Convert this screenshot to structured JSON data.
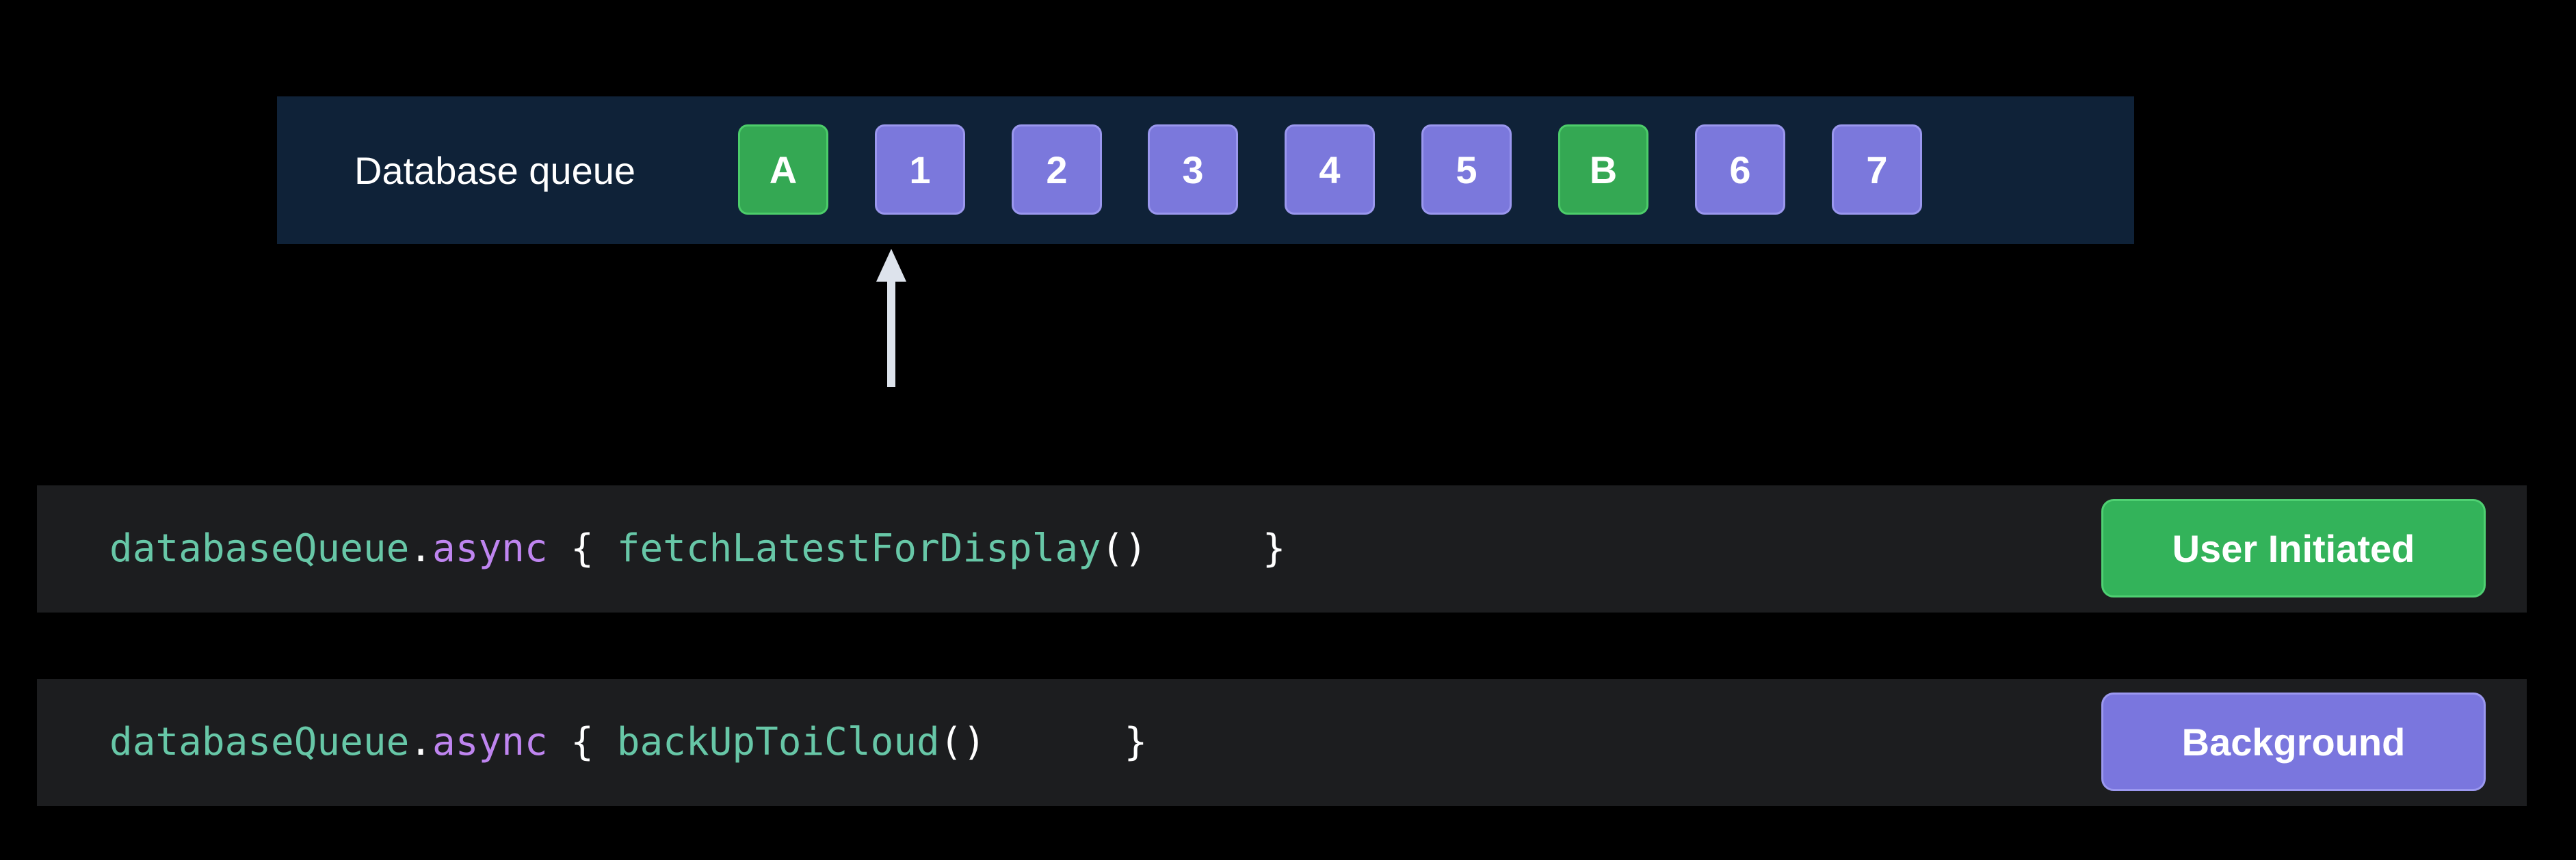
{
  "queue": {
    "label": "Database queue",
    "items": [
      {
        "text": "A",
        "kind": "green"
      },
      {
        "text": "1",
        "kind": "purple"
      },
      {
        "text": "2",
        "kind": "purple"
      },
      {
        "text": "3",
        "kind": "purple"
      },
      {
        "text": "4",
        "kind": "purple"
      },
      {
        "text": "5",
        "kind": "purple"
      },
      {
        "text": "B",
        "kind": "green"
      },
      {
        "text": "6",
        "kind": "purple"
      },
      {
        "text": "7",
        "kind": "purple"
      }
    ]
  },
  "pointer": {
    "icon": "up-arrow-icon"
  },
  "rows": [
    {
      "object": "databaseQueue",
      "dot": ".",
      "method": "async",
      "open": " { ",
      "call": "fetchLatestForDisplay",
      "parens": "()",
      "close": "     }",
      "priority": "User Initiated"
    },
    {
      "object": "databaseQueue",
      "dot": ".",
      "method": "async",
      "open": " { ",
      "call": "backUpToiCloud",
      "parens": "()",
      "close": "      }",
      "priority": "Background"
    }
  ],
  "colors": {
    "background": "#000000",
    "queue_bar": "#0f2238",
    "code_row": "#1c1d1f",
    "green": "#34a853",
    "purple": "#7b78dc",
    "code_identifier": "#67c7a7",
    "code_keyword": "#bf85f0"
  }
}
